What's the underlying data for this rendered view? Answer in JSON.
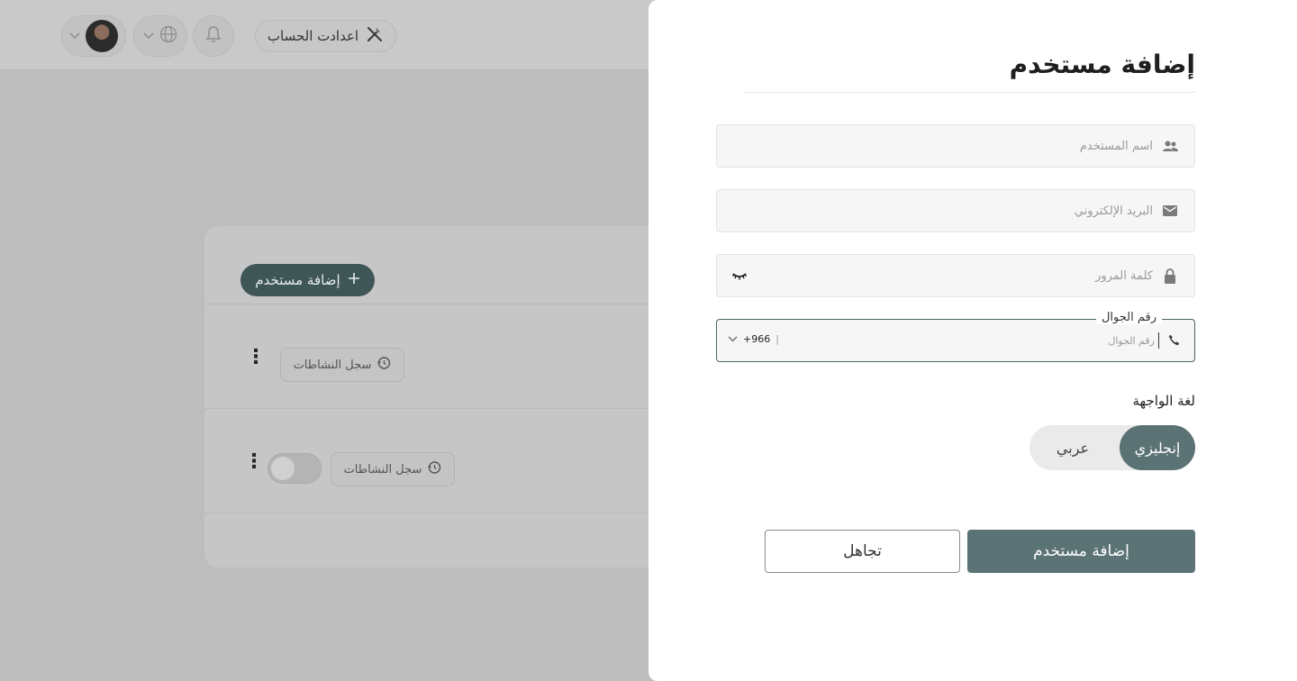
{
  "header": {
    "settings_label": "اعدادت الحساب",
    "icons": [
      "wrench-screwdriver-icon",
      "bell-icon",
      "globe-icon",
      "chevron-down-icon",
      "avatar"
    ]
  },
  "background_card": {
    "add_user_label": "إضافة مستخدم",
    "activity_log_label": "سجل النشاطات",
    "rows": [
      {
        "activity_label": "سجل النشاطات",
        "has_toggle": false
      },
      {
        "activity_label": "سجل النشاطات",
        "has_toggle": true,
        "toggle_on": false
      }
    ]
  },
  "drawer": {
    "title": "إضافة مستخدم",
    "fields": {
      "username_placeholder": "اسم المستخدم",
      "email_placeholder": "البريد الإلكتروني",
      "password_placeholder": "كلمة المرور",
      "phone_legend": "رقم الجوال",
      "phone_placeholder": "رقم الجوال",
      "country_code": "+966"
    },
    "language": {
      "label": "لغة الواجهة",
      "options": [
        "إنجليزي",
        "عربي"
      ],
      "selected": "إنجليزي"
    },
    "submit_label": "إضافة مستخدم",
    "cancel_label": "تجاهل"
  },
  "colors": {
    "accent": "#5b7375",
    "accent_dark": "#3f5657",
    "overlay": "#bdbdbd"
  }
}
